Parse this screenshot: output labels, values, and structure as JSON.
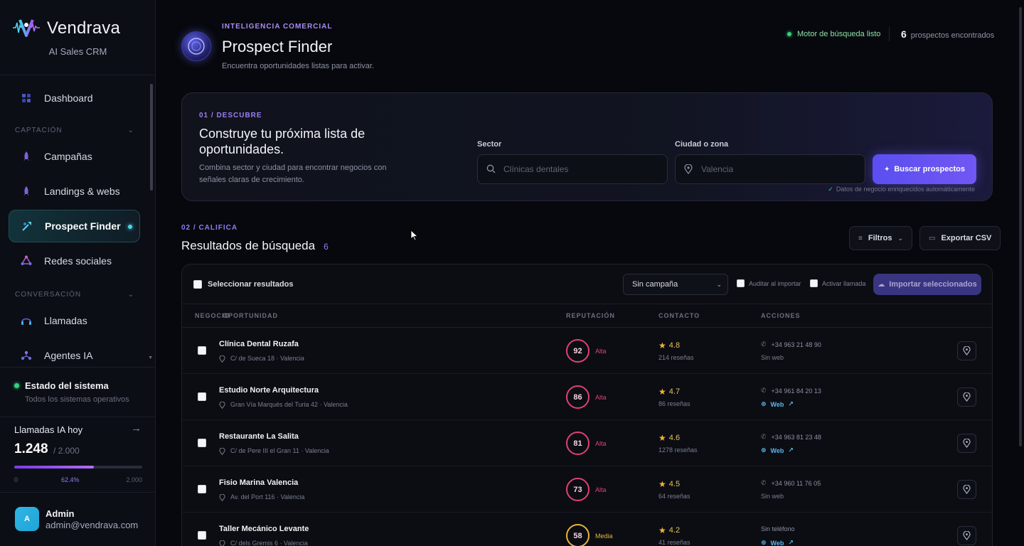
{
  "brand": {
    "name": "Vendrava",
    "subtitle": "AI Sales CRM"
  },
  "sidebar": {
    "dashboard": "Dashboard",
    "section_captacion": "CAPTACIÓN",
    "campanas": "Campañas",
    "landings": "Landings & webs",
    "prospect": "Prospect Finder",
    "redes": "Redes sociales",
    "section_conversacion": "CONVERSACIÓN",
    "llamadas": "Llamadas",
    "agentes": "Agentes IA",
    "system_title": "Estado del sistema",
    "system_sub": "Todos los sistemas operativos",
    "calls_title": "Llamadas IA hoy",
    "calls_value": "1.248",
    "calls_max": "/ 2.000",
    "calls_progress": 0.624,
    "bar_min": "0",
    "bar_pct": "62.4%",
    "bar_max": "2.000",
    "user_initial": "A",
    "user_name": "Admin",
    "user_email": "admin@vendrava.com"
  },
  "header": {
    "eyebrow": "INTELIGENCIA COMERCIAL",
    "title": "Prospect Finder",
    "subtitle": "Encuentra oportunidades listas para activar.",
    "engine_status": "Motor de búsqueda listo",
    "found_count": "6",
    "found_label": "prospectos encontrados"
  },
  "discover": {
    "step": "01 / DESCUBRE",
    "title": "Construye tu próxima lista de oportunidades.",
    "text": "Combina sector y ciudad para encontrar negocios con señales claras de crecimiento.",
    "sector_label": "Sector",
    "sector_placeholder": "Clínicas dentales",
    "city_label": "Ciudad o zona",
    "city_placeholder": "Valencia",
    "search_button": "Buscar prospectos",
    "enriched_note": "Datos de negocio enriquecidos automáticamente"
  },
  "qualify": {
    "step": "02 / CALIFICA",
    "title": "Resultados de búsqueda",
    "count": "6",
    "filters": "Filtros",
    "export": "Exportar CSV"
  },
  "results": {
    "select_all": "Seleccionar resultados",
    "campaign": "Sin campaña",
    "audit": "Auditar al importar",
    "call": "Activar llamada",
    "import": "Importar seleccionados",
    "headers": {
      "negocio": "NEGOCIO",
      "oportunidad": "OPORTUNIDAD",
      "reputacion": "REPUTACIÓN",
      "contacto": "CONTACTO",
      "acciones": "ACCIONES"
    },
    "rows": [
      {
        "name": "Clínica Dental Ruzafa",
        "address": "C/ de Sueca 18 · Valencia",
        "score": "92",
        "score_label": "Alta",
        "rating": "4.8",
        "reviews": "214 reseñas",
        "phone": "+34 963 21 48 90",
        "web": "Sin web"
      },
      {
        "name": "Estudio Norte Arquitectura",
        "address": "Gran Vía Marqués del Turia 42 · Valencia",
        "score": "86",
        "score_label": "Alta",
        "rating": "4.7",
        "reviews": "86 reseñas",
        "phone": "+34 961 84 20 13",
        "web": "Web"
      },
      {
        "name": "Restaurante La Salita",
        "address": "C/ de Pere III el Gran 11 · Valencia",
        "score": "81",
        "score_label": "Alta",
        "rating": "4.6",
        "reviews": "1278 reseñas",
        "phone": "+34 963 81 23 48",
        "web": "Web"
      },
      {
        "name": "Fisio Marina Valencia",
        "address": "Av. del Port 116 · Valencia",
        "score": "73",
        "score_label": "Alta",
        "rating": "4.5",
        "reviews": "64 reseñas",
        "phone": "+34 960 11 76 05",
        "web": "Sin web"
      },
      {
        "name": "Taller Mecánico Levante",
        "address": "C/ dels Gremis 6 · Valencia",
        "score": "58",
        "score_label": "Media",
        "rating": "4.2",
        "reviews": "41 reseñas",
        "phone": "Sin teléfono",
        "web": "Web"
      }
    ]
  },
  "colors": {
    "accent": "#6c55f2",
    "high": "#e0426f",
    "medium": "#e8b53a",
    "ok": "#33d17a",
    "link": "#5ab8ef"
  }
}
